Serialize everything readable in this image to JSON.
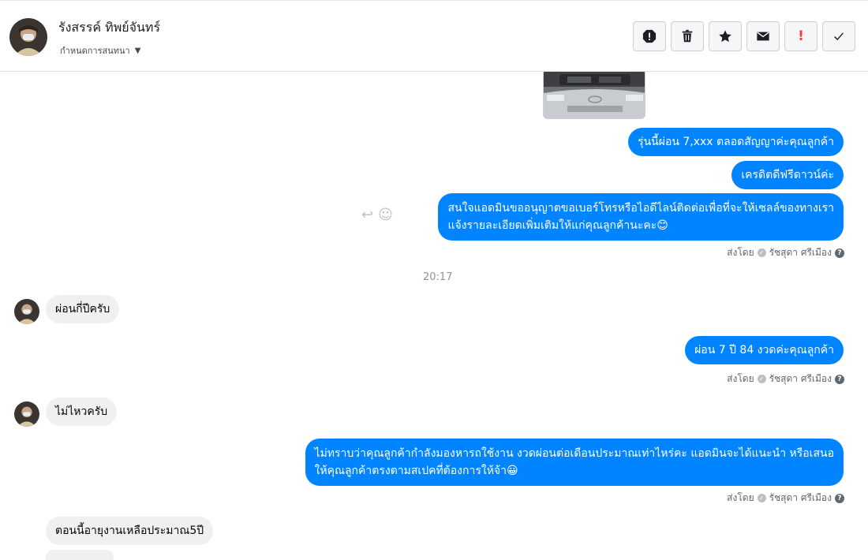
{
  "header": {
    "contact_name": "รังสรรค์ ทิพย์จันทร์",
    "assign_label": "กำหนดการสนทนา"
  },
  "toolbar": {
    "red_mark": "!"
  },
  "messages": {
    "out_1": "รุ่นนี้ผ่อน 7,xxx ตลอดสัญญาค่ะคุณลูกค้า",
    "out_2": "เครดิตดีฟรีดาวน์ค่ะ",
    "out_3_line1": "สนใจแอดมินขออนุญาตขอเบอร์โทรหรือไอดีไลน์ติดต่อเพื่อที่จะให้เซลล์ของทางเรา",
    "out_3_line2": "แจ้งรายละเอียดเพิ่มเติมให้แก่คุณลูกค้านะคะ😊",
    "time_1": "20:17",
    "in_1": "ผ่อนกี่ปีครับ",
    "out_4": "ผ่อน 7 ปี 84 งวดค่ะคุณลูกค้า",
    "in_2": "ไม่ไหวครับ",
    "out_5_line1": "ไม่ทราบว่าคุณลูกค้ากำลังมองหารถใช้งาน งวดผ่อนต่อเดือนประมาณเท่าไหร่คะ แอดมินจะได้แนะนำ หรือเสนอ",
    "out_5_line2": "ให้คุณลูกค้าตรงตามสเปคที่ต้องการให้จ้า😀",
    "in_3": "ตอนนี้อายุงานเหลือประมาณ5ปี"
  },
  "sent_by": {
    "prefix": "ส่งโดย",
    "agent": "รัชสุดา ศรีเมือง"
  },
  "colors": {
    "outgoing_bubble": "#0084ff",
    "incoming_bubble": "#f0f0f0",
    "alert_red": "#fa383e"
  },
  "icons": [
    "alert-icon",
    "trash-icon",
    "star-icon",
    "envelope-icon",
    "exclamation-icon",
    "check-icon",
    "reply-icon",
    "smiley-icon"
  ]
}
